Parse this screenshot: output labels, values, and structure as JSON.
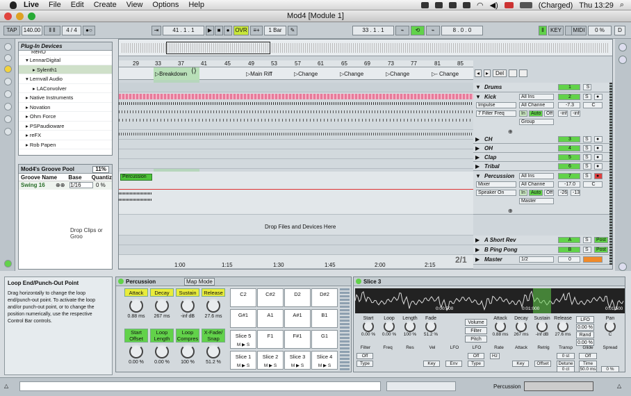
{
  "menu": {
    "app": "Live",
    "items": [
      "File",
      "Edit",
      "Create",
      "View",
      "Options",
      "Help"
    ],
    "battery": "(Charged)",
    "time": "Thu 13:29"
  },
  "window": {
    "title": "Mod4  [Module 1]"
  },
  "control": {
    "tap": "TAP",
    "tempo": "140.00",
    "signature": "4 / 4",
    "position": "41 .  1 .  1",
    "ovr": "OVR",
    "quant": "1 Bar",
    "loop_start": "33 .  1 .  1",
    "loop_len": "8 .  0 .  0",
    "key": "KEY",
    "midi": "MIDI",
    "cpu": "0 %",
    "disk": "D"
  },
  "browser": {
    "title": "Plug-In Devices",
    "items": [
      "ReRO",
      "LennarDigital",
      "Sylenth1",
      "Lernvall Audio",
      "LAConvolver",
      "Native Instruments",
      "Novation",
      "Ohm Force",
      "PSPaudioware",
      "reFX",
      "Rob Papen"
    ]
  },
  "groove": {
    "title": "Mod4's Groove Pool",
    "percent": "11%",
    "col_name": "Groove Name",
    "col_base": "Base",
    "col_quant": "Quantiz",
    "row_name": "Swing 16",
    "row_base": "1/16",
    "row_quant": "0 %",
    "drop": "Drop Clips or Groo"
  },
  "ruler": {
    "bars": [
      "29",
      "33",
      "37",
      "41",
      "45",
      "49",
      "53",
      "57",
      "61",
      "65",
      "69",
      "73",
      "77",
      "81",
      "85"
    ],
    "times": [
      "1:00",
      "1:15",
      "1:30",
      "1:45",
      "2:00",
      "2:15"
    ],
    "zoom": "2/1"
  },
  "locators": [
    "Breakdown",
    "Main Riff",
    "Change",
    "Change",
    "Change",
    "- Change"
  ],
  "locator_ctrl": "Del",
  "tracks": {
    "drums": "Drums",
    "kick": "Kick",
    "ch": "CH",
    "oh": "OH",
    "clap": "Clap",
    "tribal": "Tribal",
    "percussion": "Percussion",
    "ashort": "A Short Rev",
    "bping": "B Ping Pong",
    "master": "Master"
  },
  "kick": {
    "input": "All Ins",
    "channel": "All Channe",
    "impulse": "Impulse",
    "filter": "7 Filter Freq",
    "in": "In",
    "auto": "Auto",
    "off": "Off",
    "num": "2",
    "vol": "-7.3",
    "pan": "C",
    "peak1": "-inf",
    "peak2": "-inf",
    "group": "Group"
  },
  "nums": {
    "drums": "1",
    "ch": "3",
    "oh": "4",
    "clap": "5",
    "tribal": "6",
    "perc": "7",
    "a": "A",
    "b": "B",
    "master": "0"
  },
  "perc": {
    "input": "All Ins",
    "mixer": "Mixer",
    "channel": "All Channe",
    "speaker": "Speaker On",
    "in": "In",
    "auto": "Auto",
    "off": "Off",
    "vol": "-17.0",
    "pan": "C",
    "peak1": "-26",
    "peak2": "-13",
    "out": "Master",
    "clip": "Percussion"
  },
  "returns": {
    "s": "S",
    "post": "Post",
    "master_cue": "1/2",
    "master_vol": "0"
  },
  "drop_devices": "Drop Files and Devices Here",
  "info": {
    "title": "Loop End/Punch-Out Point",
    "text": "Drag horizontally to change the loop end/punch-out point. To activate the loop and/or punch-out point, or to change the position numerically, use the respective Control Bar controls."
  },
  "rack": {
    "title": "Percussion",
    "map": "Map Mode",
    "macros1": [
      {
        "name": "Attack",
        "val": "0.88 ms"
      },
      {
        "name": "Decay",
        "val": "267 ms"
      },
      {
        "name": "Sustain",
        "val": "-inf dB"
      },
      {
        "name": "Release",
        "val": "27.6 ms"
      }
    ],
    "macros2": [
      {
        "name": "Start Offset",
        "val": "0.00 %"
      },
      {
        "name": "Loop Length",
        "val": "0.00 %"
      },
      {
        "name": "Loop Compres",
        "val": "100 %"
      },
      {
        "name": "X-Fade/ Snap",
        "val": "51.2 %"
      }
    ],
    "pads": [
      "C2",
      "C#2",
      "D2",
      "D#2",
      "G#1",
      "A1",
      "A#1",
      "B1",
      "Slice 5",
      "F1",
      "F#1",
      "G1",
      "Slice 1",
      "Slice 2",
      "Slice 3",
      "Slice 4"
    ]
  },
  "simpler": {
    "title": "Slice 3",
    "times": [
      "0:00:500",
      "0:01:000",
      "0:01:500"
    ],
    "knobs1": [
      {
        "name": "Start",
        "val": "0.00 %"
      },
      {
        "name": "Loop",
        "val": "0.00 %"
      },
      {
        "name": "Length",
        "val": "100 %"
      },
      {
        "name": "Fade",
        "val": "51.2 %"
      }
    ],
    "volume": "Volume",
    "filter_btn": "Filter",
    "pitch": "Pitch",
    "env": [
      {
        "name": "Attack",
        "val": "0.88 ms"
      },
      {
        "name": "Decay",
        "val": "267 ms"
      },
      {
        "name": "Sustain",
        "val": "-inf dB"
      },
      {
        "name": "Release",
        "val": "27.6 ms"
      }
    ],
    "lfo": "LFO",
    "lfo_val": "0.00 %",
    "rand": "Rand",
    "rand_val": "0.00 %",
    "pan": "Pan",
    "pan_val": "C",
    "row2": [
      "Filter",
      "Freq",
      "Res",
      "Vel",
      "LFO",
      "LFO",
      "Rate",
      "Attack",
      "Retrig",
      "Transp",
      "Glide",
      "Spread"
    ],
    "off": "Off",
    "type": "Type",
    "key": "Key",
    "env2": "Env",
    "hz": "Hz",
    "offset": "Offset",
    "detune": "Detune",
    "time": "Time",
    "transp": "0 st",
    "detune_val": "0 ct",
    "time_val": "50.0 ms",
    "glide": "Off",
    "spread_val": "0 %"
  },
  "status": {
    "track": "Percussion"
  }
}
